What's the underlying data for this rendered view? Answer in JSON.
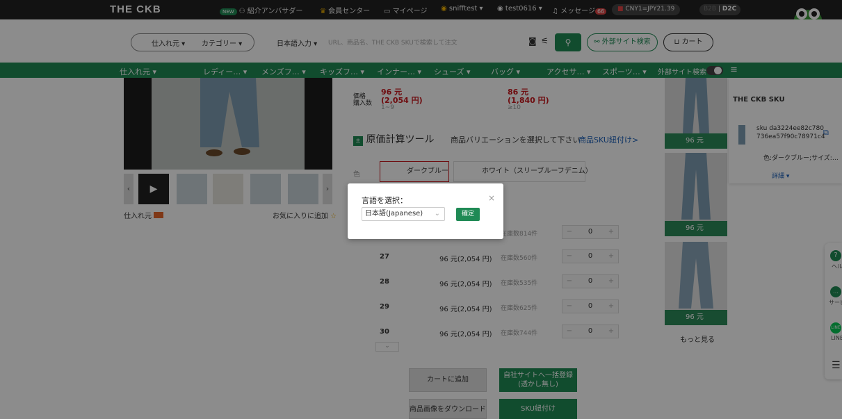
{
  "topbar": {
    "logo": "THE CKB",
    "new_badge": "NEW",
    "ambassador": "紹介アンバサダー",
    "member_center": "会員センター",
    "mypage": "マイページ",
    "account1": "snifftest",
    "account2": "test0616",
    "messages": "メッセージ",
    "message_count": "66",
    "currency": "CNY1=JPY21.39",
    "b2b": "B2B",
    "d2c": "D2C"
  },
  "header": {
    "source_select": "仕入れ元",
    "category_select": "カテゴリー",
    "input_lang": "日本語入力",
    "search_placeholder": "URL、商品名、THE CKB SKUで検索して注文",
    "external_search": "外部サイト検索",
    "cart": "カート"
  },
  "nav": {
    "items": [
      "仕入れ元",
      "レディー…",
      "メンズフ…",
      "キッズフ…",
      "インナー…",
      "シューズ",
      "バッグ",
      "アクセサ…",
      "スポーツ…"
    ],
    "external_search": "外部サイト検索"
  },
  "product": {
    "source_label": "仕入れ元",
    "favorite": "お気に入りに追加",
    "price_label": "価格",
    "qty_label": "購入数",
    "price1": "96 元",
    "price1_jpy": "(2,054 円)",
    "qty1": "1~9",
    "price2": "86 元",
    "price2_jpy": "(1,840 円)",
    "qty2": "≥10",
    "calc_tool": "原価計算ツール",
    "select_variation": "商品バリエーションを選択して下さい",
    "sku_link": "商品SKU紐付け>",
    "color_label": "色",
    "color_options": [
      "ダークブルー",
      "ホワイト（スリーブルーフデニム）"
    ],
    "sizes": [
      {
        "size": "",
        "price": "",
        "stock": "在庫数814件",
        "qty": "0"
      },
      {
        "size": "27",
        "price": "96 元(2,054 円)",
        "stock": "在庫数560件",
        "qty": "0"
      },
      {
        "size": "28",
        "price": "96 元(2,054 円)",
        "stock": "在庫数535件",
        "qty": "0"
      },
      {
        "size": "29",
        "price": "96 元(2,054 円)",
        "stock": "在庫数625件",
        "qty": "0"
      },
      {
        "size": "30",
        "price": "96 元(2,054 円)",
        "stock": "在庫数744件",
        "qty": "0"
      }
    ],
    "add_to_cart": "カートに追加",
    "bulk_register": "自社サイトへ一括登録",
    "bulk_register_sub": "(透かし無し)",
    "download_images": "商品画像をダウンロード",
    "sku_bind": "SKU紐付け"
  },
  "related": {
    "prices": [
      "96 元",
      "96 元",
      "96 元"
    ],
    "more": "もっと見る"
  },
  "sku_panel": {
    "title": "THE CKB SKU",
    "sku_line1": "sku da3224ee82c780",
    "sku_line2": "736ea57f90c78971c4",
    "variant": "色:ダークブルー;サイズ:…",
    "detail": "詳細"
  },
  "float": {
    "help": "ヘル",
    "service": "サービ",
    "line": "LINE"
  },
  "modal": {
    "title": "言語を選択：",
    "selected_language": "日本語(Japanese)",
    "confirm": "確定"
  },
  "colors": {
    "brand_green": "#1f8a55",
    "price_red": "#c8161d",
    "topbar_bg": "#222222"
  }
}
